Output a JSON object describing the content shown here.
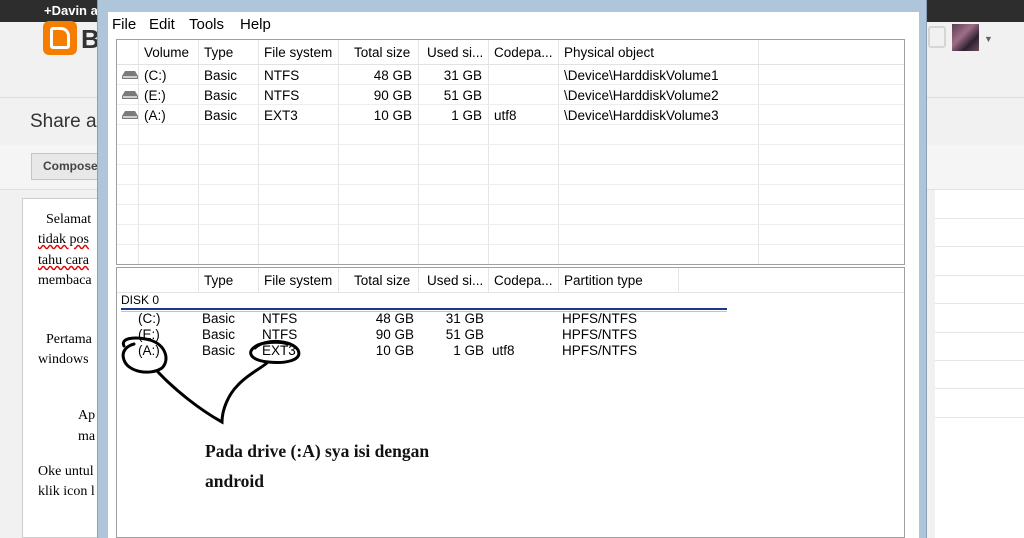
{
  "background_page": {
    "topbar_user": "+Davin a",
    "logo_letter": "B",
    "share_title": "Share al",
    "compose_button": "Compose",
    "editor_lines": [
      "Selamat",
      "tidak pos",
      "tahu cara",
      "membaca",
      "Pertama",
      "windows",
      "Ap",
      "ma",
      "Oke untul",
      "klik icon l"
    ]
  },
  "menu": [
    "File",
    "Edit",
    "Tools",
    "Help"
  ],
  "volumes_table": {
    "columns": [
      "Volume",
      "Type",
      "File system",
      "Total size",
      "Used si...",
      "Codepa...",
      "Physical object"
    ],
    "rows": [
      {
        "icon": "drive-icon",
        "volume": "(C:)",
        "type": "Basic",
        "fs": "NTFS",
        "total": "48 GB",
        "used": "31 GB",
        "codepage": "",
        "physical": "\\Device\\HarddiskVolume1"
      },
      {
        "icon": "drive-icon",
        "volume": "(E:)",
        "type": "Basic",
        "fs": "NTFS",
        "total": "90 GB",
        "used": "51 GB",
        "codepage": "",
        "physical": "\\Device\\HarddiskVolume2"
      },
      {
        "icon": "drive-icon",
        "volume": "(A:)",
        "type": "Basic",
        "fs": "EXT3",
        "total": "10 GB",
        "used": "1 GB",
        "codepage": "utf8",
        "physical": "\\Device\\HarddiskVolume3"
      }
    ]
  },
  "partitions_table": {
    "columns": [
      "",
      "Type",
      "File system",
      "Total size",
      "Used si...",
      "Codepa...",
      "Partition type"
    ],
    "disk_label": "DISK 0",
    "rows": [
      {
        "volume": "(C:)",
        "type": "Basic",
        "fs": "NTFS",
        "total": "48 GB",
        "used": "31 GB",
        "codepage": "",
        "ptype": "HPFS/NTFS"
      },
      {
        "volume": "(E:)",
        "type": "Basic",
        "fs": "NTFS",
        "total": "90 GB",
        "used": "51 GB",
        "codepage": "",
        "ptype": "HPFS/NTFS"
      },
      {
        "volume": "(A:)",
        "type": "Basic",
        "fs": "EXT3",
        "total": "10 GB",
        "used": "1 GB",
        "codepage": "utf8",
        "ptype": "HPFS/NTFS"
      }
    ]
  },
  "annotation": {
    "line1": "Pada drive (:A) sya isi dengan",
    "line2": "android"
  }
}
